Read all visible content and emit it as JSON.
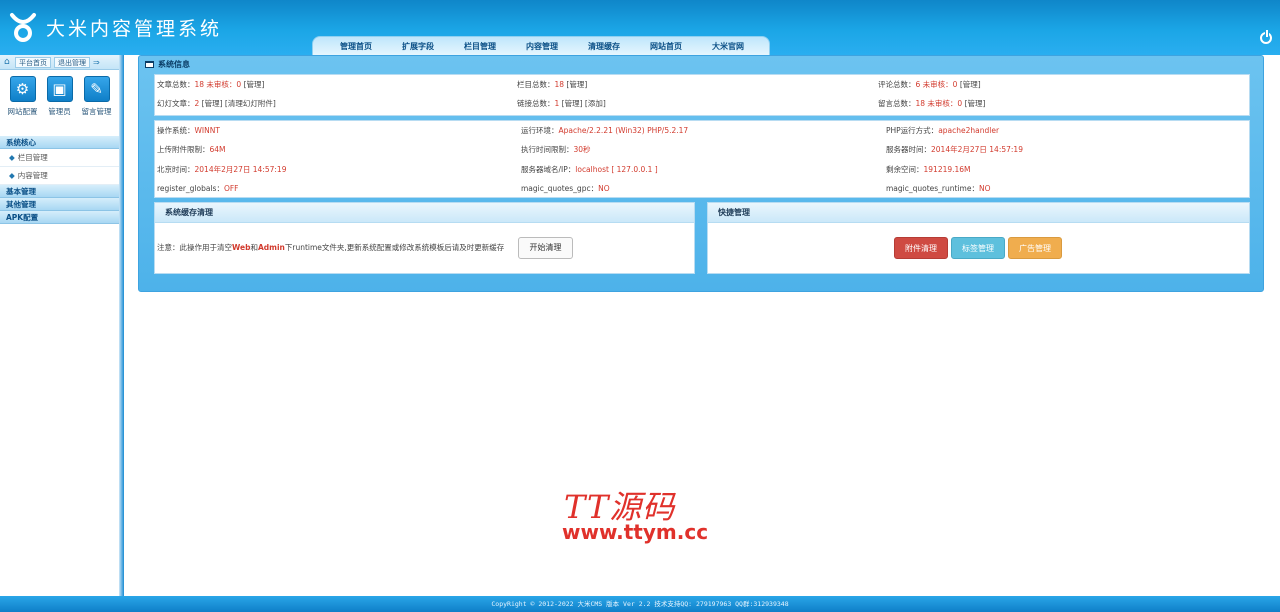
{
  "header": {
    "logo_text": "大米内容管理系统",
    "nav": [
      "管理首页",
      "扩展字段",
      "栏目管理",
      "内容管理",
      "清理缓存",
      "网站首页",
      "大米官网"
    ]
  },
  "sidebar": {
    "top_links": [
      "平台首页",
      "退出管理"
    ],
    "shortcuts": [
      "网站配置",
      "管理员",
      "留言管理"
    ],
    "groups": [
      {
        "label": "系统核心",
        "items": [
          "栏目管理",
          "内容管理"
        ]
      },
      {
        "label": "基本管理"
      },
      {
        "label": "其他管理"
      },
      {
        "label": "APK配置"
      }
    ]
  },
  "main": {
    "title": "系统信息",
    "stats": {
      "articles_label": "文章总数：",
      "articles_value": "18",
      "articles_unreviewed": " 未审核：0",
      "articles_manage": " [管理]",
      "slides_label": "幻灯文章：",
      "slides_value": "2",
      "slides_actions": " [管理] [清理幻灯附件]",
      "columns_label": "栏目总数：",
      "columns_value": "18",
      "columns_manage": " [管理]",
      "links_label": "链接总数：",
      "links_value": "1",
      "links_actions": " [管理] [添加]",
      "comments_label": "评论总数：",
      "comments_value": "6",
      "comments_unreviewed": " 未审核：0",
      "comments_manage": " [管理]",
      "messages_label": "留言总数：",
      "messages_value": "18",
      "messages_unreviewed": " 未审核：0",
      "messages_manage": " [管理]"
    },
    "env": {
      "os_label": "操作系统：",
      "os_value": "WINNT",
      "runtime_label": "运行环境：",
      "runtime_value": "Apache/2.2.21 (Win32) PHP/5.2.17",
      "php_mode_label": "PHP运行方式：",
      "php_mode_value": "apache2handler",
      "upload_label": "上传附件限制：",
      "upload_value": "64M",
      "exec_label": "执行时间限制：",
      "exec_value": "30秒",
      "server_time_label": "服务器时间：",
      "server_time_value": "2014年2月27日 14:57:19",
      "beijing_label": "北京时间：",
      "beijing_value": "2014年2月27日 14:57:19",
      "domain_label": "服务器域名/IP：",
      "domain_value": "localhost [ 127.0.0.1 ]",
      "space_label": "剩余空间：",
      "space_value": "191219.16M",
      "globals_label": "register_globals：",
      "globals_value": "OFF",
      "gpc_label": "magic_quotes_gpc：",
      "gpc_value": "NO",
      "runtime_q_label": "magic_quotes_runtime：",
      "runtime_q_value": "NO"
    },
    "cache": {
      "title": "系统缓存清理",
      "note_prefix": "注意：此操作用于清空",
      "note_web": "Web",
      "note_and": "和",
      "note_admin": "Admin",
      "note_suffix": "下runtime文件夹,更新系统配置或修改系统模板后请及时更新缓存",
      "button": "开始清理"
    },
    "quick": {
      "title": "快捷管理",
      "buttons": [
        "附件清理",
        "标签管理",
        "广告管理"
      ]
    }
  },
  "watermark": {
    "line1": "TT源码",
    "line2": "www.ttym.cc"
  },
  "footer": {
    "text": "CopyRight © 2012-2022 大米CMS 版本 Ver 2.2 技术支持QQ: 279197963 QQ群:312939348"
  }
}
